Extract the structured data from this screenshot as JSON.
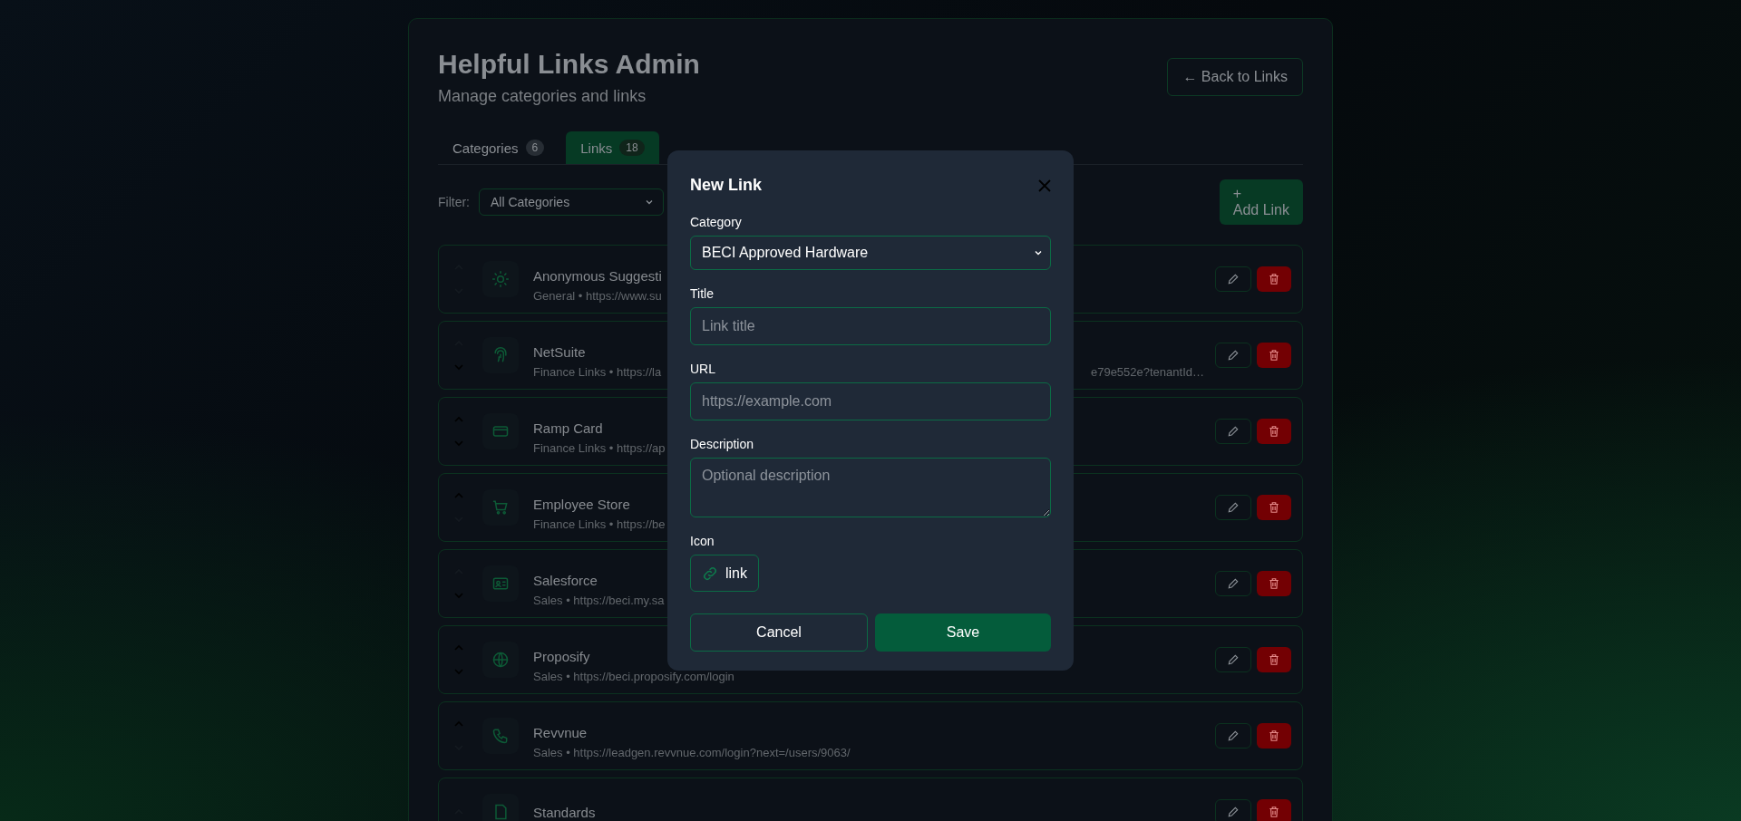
{
  "header": {
    "title": "Helpful Links Admin",
    "subtitle": "Manage categories and links",
    "back_button": "← Back to Links"
  },
  "tabs": [
    {
      "label": "Categories",
      "count": "6",
      "selected": false
    },
    {
      "label": "Links",
      "count": "18",
      "selected": true
    }
  ],
  "filter": {
    "label": "Filter:",
    "value": "All Categories"
  },
  "add_button": {
    "icon": "+",
    "label": "Add Link"
  },
  "links": [
    {
      "title": "Anonymous Suggesti",
      "subtitle": "General • https://www.su",
      "up_enabled": false,
      "down_enabled": false
    },
    {
      "title": "NetSuite",
      "subtitle": "Finance Links • https://la",
      "subtitle_tail": "e79e552e?tenantId…",
      "up_enabled": false,
      "down_enabled": true
    },
    {
      "title": "Ramp Card",
      "subtitle": "Finance Links • https://ap",
      "up_enabled": true,
      "down_enabled": true
    },
    {
      "title": "Employee Store",
      "subtitle": "Finance Links • https://be",
      "up_enabled": true,
      "down_enabled": false
    },
    {
      "title": "Salesforce",
      "subtitle": "Sales • https://beci.my.sa",
      "up_enabled": false,
      "down_enabled": true
    },
    {
      "title": "Proposify",
      "subtitle": "Sales • https://beci.proposify.com/login",
      "up_enabled": true,
      "down_enabled": true
    },
    {
      "title": "Revvnue",
      "subtitle": "Sales • https://leadgen.revvnue.com/login?next=/users/9063/",
      "up_enabled": true,
      "down_enabled": false
    },
    {
      "title": "Standards",
      "up_enabled": false
    }
  ],
  "modal": {
    "title": "New Link",
    "fields": [
      {
        "kind": "select",
        "label": "Category",
        "value": "BECI Approved Hardware"
      },
      {
        "kind": "input",
        "label": "Title",
        "placeholder": "Link title"
      },
      {
        "kind": "input",
        "label": "URL",
        "placeholder": "https://example.com"
      },
      {
        "kind": "textarea",
        "label": "Description",
        "placeholder": "Optional description"
      },
      {
        "kind": "icon",
        "label": "Icon",
        "value": "link"
      }
    ],
    "cancel": "Cancel",
    "save": "Save"
  }
}
